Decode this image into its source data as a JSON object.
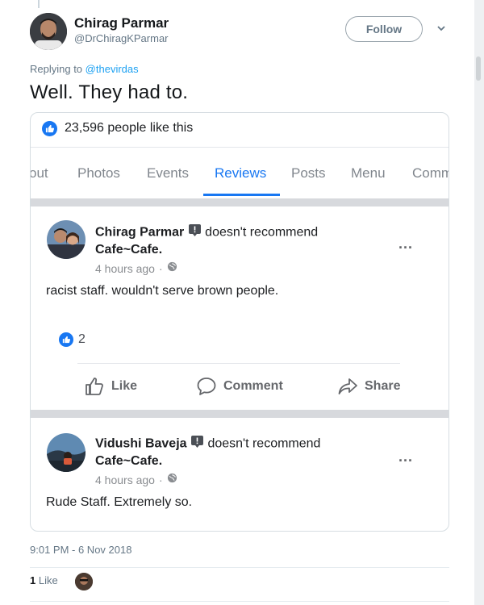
{
  "tweet": {
    "author_name": "Chirag Parmar",
    "author_handle": "@DrChiragKParmar",
    "follow_label": "Follow",
    "replying_prefix": "Replying to",
    "replying_to": "@thevirdas",
    "text": "Well. They had to.",
    "timestamp": "9:01 PM - 6 Nov 2018",
    "likes_count": "1",
    "likes_label": "Like"
  },
  "embed": {
    "page_likes": "23,596 people like this",
    "tabs": [
      {
        "label": "out",
        "active": false
      },
      {
        "label": "Photos",
        "active": false
      },
      {
        "label": "Events",
        "active": false
      },
      {
        "label": "Reviews",
        "active": true
      },
      {
        "label": "Posts",
        "active": false
      },
      {
        "label": "Menu",
        "active": false
      },
      {
        "label": "Comm",
        "active": false
      }
    ],
    "reviews": [
      {
        "name": "Chirag Parmar",
        "verb": "doesn't recommend",
        "place": "Cafe~Cafe.",
        "time": "4 hours ago",
        "body": "racist staff. wouldn't serve brown people.",
        "reaction_count": "2",
        "more": "..."
      },
      {
        "name": "Vidushi Baveja",
        "verb": "doesn't recommend",
        "place": "Cafe~Cafe.",
        "time": "4 hours ago",
        "body": "Rude Staff. Extremely so.",
        "more": "..."
      }
    ],
    "actions": {
      "like": "Like",
      "comment": "Comment",
      "share": "Share"
    },
    "time_separator": "·"
  },
  "colors": {
    "twitter_blue": "#1da1f2",
    "facebook_blue": "#1877f2",
    "muted": "#657786"
  },
  "icons": [
    "caret-down-icon",
    "thumbs-up-icon",
    "globe-icon",
    "review-badge-icon",
    "comment-icon",
    "share-icon"
  ]
}
